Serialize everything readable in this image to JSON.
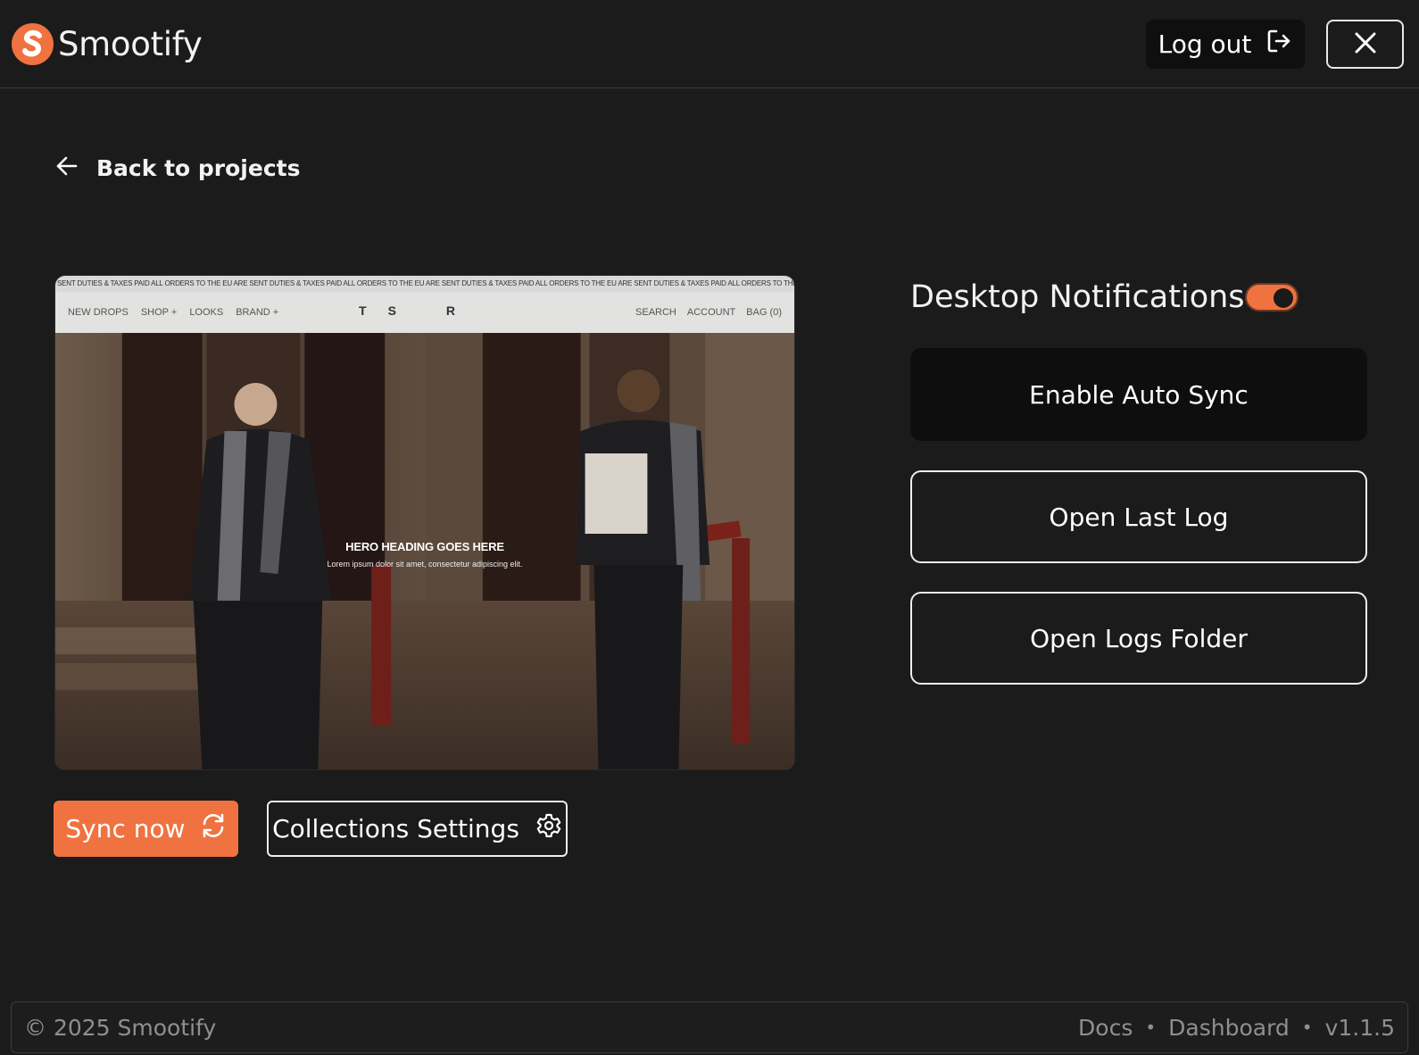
{
  "header": {
    "brand_name": "Smootify",
    "logout_label": "Log out"
  },
  "nav": {
    "back_label": "Back to projects"
  },
  "preview": {
    "ticker": "SENT DUTIES & TAXES PAID      ALL ORDERS TO THE EU ARE SENT DUTIES & TAXES PAID      ALL ORDERS TO THE EU ARE SENT DUTIES & TAXES PAID      ALL ORDERS TO THE EU ARE SENT DUTIES & TAXES PAID      ALL ORDERS TO THE EU ARE",
    "nav_left": [
      "NEW DROPS",
      "SHOP +",
      "LOOKS",
      "BRAND +"
    ],
    "nav_center": [
      "T",
      "S",
      "R"
    ],
    "nav_right": [
      "SEARCH",
      "ACCOUNT",
      "BAG (0)"
    ],
    "hero_heading": "HERO HEADING GOES HERE",
    "hero_sub": "Lorem ipsum dolor sit amet, consectetur adipiscing elit."
  },
  "actions": {
    "sync_label": "Sync now",
    "collections_label": "Collections Settings"
  },
  "settings": {
    "notifications_label": "Desktop Notifications",
    "notifications_enabled": true,
    "auto_sync_label": "Enable Auto Sync",
    "last_log_label": "Open Last Log",
    "logs_folder_label": "Open Logs Folder"
  },
  "footer": {
    "copyright": "© 2025 Smootify",
    "docs": "Docs",
    "separator": "•",
    "dashboard": "Dashboard",
    "version": "v1.1.5"
  },
  "colors": {
    "background": "#1b1b1b",
    "accent": "#ef7240",
    "dark_button": "#0e0e0e"
  },
  "icons": [
    "smootify-logo-icon",
    "logout-icon",
    "close-icon",
    "arrow-left-icon",
    "refresh-icon",
    "gear-icon"
  ]
}
